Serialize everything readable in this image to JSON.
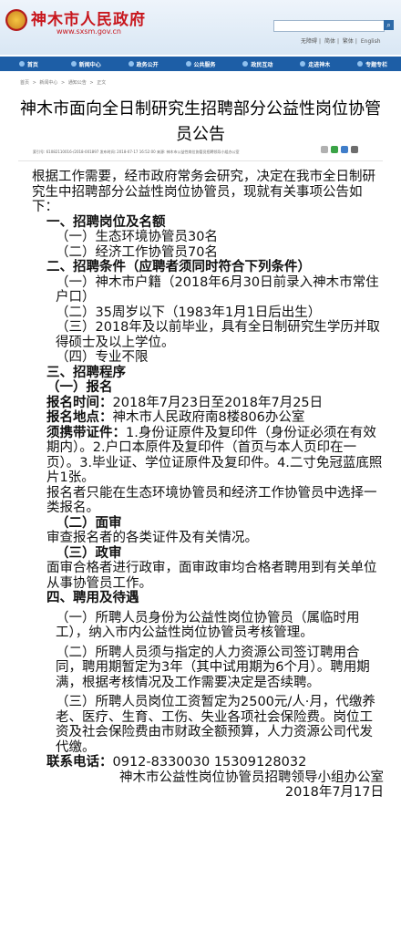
{
  "header": {
    "site_title": "神木市人民政府",
    "site_url": "www.sxsm.gov.cn",
    "links": [
      "无障碍",
      "简体",
      "繁体",
      "English"
    ]
  },
  "nav": {
    "items": [
      "首页",
      "新闻中心",
      "政务公开",
      "公共服务",
      "政民互动",
      "走进神木",
      "专题专栏"
    ]
  },
  "breadcrumb": [
    "首页",
    ">",
    "新闻中心",
    ">",
    "通知公告",
    ">",
    "正文"
  ],
  "article": {
    "title": "神木市面向全日制研究生招聘部分公益性岗位协管员公告",
    "meta": "索引号: 61082110016-/2018-001897    发布时间: 2018-07-17 16:52:00    来源: 神木市公益性岗位协管员招聘领导小组办公室",
    "paragraphs": [
      {
        "text": "根据工作需要，经市政府常务会研究，决定在我市全日制研究生中招聘部分公益性岗位协管员，现就有关事项公告如下：",
        "style": ""
      },
      {
        "text": "一、招聘岗位及名额",
        "style": "b i1"
      },
      {
        "text": "（一）生态环境协管员30名",
        "style": "i2"
      },
      {
        "text": "（二）经济工作协管员70名",
        "style": "i2"
      },
      {
        "text": "二、招聘条件（应聘者须同时符合下列条件）",
        "style": "b i1"
      },
      {
        "text": "（一）神木市户籍（2018年6月30日前录入神木市常住户口）",
        "style": "i2"
      },
      {
        "text": "（二）35周岁以下（1983年1月1日后出生）",
        "style": "i2"
      },
      {
        "text": "（三）2018年及以前毕业，具有全日制研究生学历并取得硕士及以上学位。",
        "style": "i2"
      },
      {
        "text": "（四）专业不限",
        "style": "i2"
      },
      {
        "text": "三、招聘程序",
        "style": "b i1"
      },
      {
        "text": "（一）报名",
        "style": "b i1"
      },
      {
        "label": "报名时间：",
        "text": "2018年7月23日至2018年7月25日",
        "style": "i1"
      },
      {
        "label": "报名地点：",
        "text": "神木市人民政府南8楼806办公室",
        "style": "i1"
      },
      {
        "label": "须携带证件：",
        "text": "1.身份证原件及复印件（身份证必须在有效期内）。2.户口本原件及复印件（首页与本人页印在一页）。3.毕业证、学位证原件及复印件。4.二寸免冠蓝底照片1张。",
        "style": "i1"
      },
      {
        "text": "报名者只能在生态环境协管员和经济工作协管员中选择一类报名。",
        "style": "i1"
      },
      {
        "text": "（二）面审",
        "style": "b i2"
      },
      {
        "text": "审查报名者的各类证件及有关情况。",
        "style": "i1"
      },
      {
        "text": "（三）政审",
        "style": "b i2"
      },
      {
        "text": "面审合格者进行政审，面审政审均合格者聘用到有关单位从事协管员工作。",
        "style": "i1"
      },
      {
        "text": "四、聘用及待遇",
        "style": "b i1"
      },
      {
        "text": "（一）所聘人员身份为公益性岗位协管员（属临时用工），纳入市内公益性岗位协管员考核管理。",
        "style": "i2 spaced"
      },
      {
        "text": "（二）所聘人员须与指定的人力资源公司签订聘用合同，聘用期暂定为3年（其中试用期为6个月）。聘用期满，根据考核情况及工作需要决定是否续聘。",
        "style": "i2 spaced"
      },
      {
        "text": "（三）所聘人员岗位工资暂定为2500元/人·月，代缴养老、医疗、生育、工伤、失业各项社会保险费。岗位工资及社会保险费由市财政全额预算，人力资源公司代发代缴。",
        "style": "i2 spaced"
      },
      {
        "label": "联系电话：",
        "text": "0912-8330030 15309128032",
        "style": "i1"
      },
      {
        "text": "神木市公益性岗位协管员招聘领导小组办公室",
        "style": "sign"
      },
      {
        "text": "2018年7月17日",
        "style": "sign"
      }
    ]
  },
  "colors": {
    "brand_red": "#c8161d",
    "nav_blue": "#1d5ea6"
  }
}
